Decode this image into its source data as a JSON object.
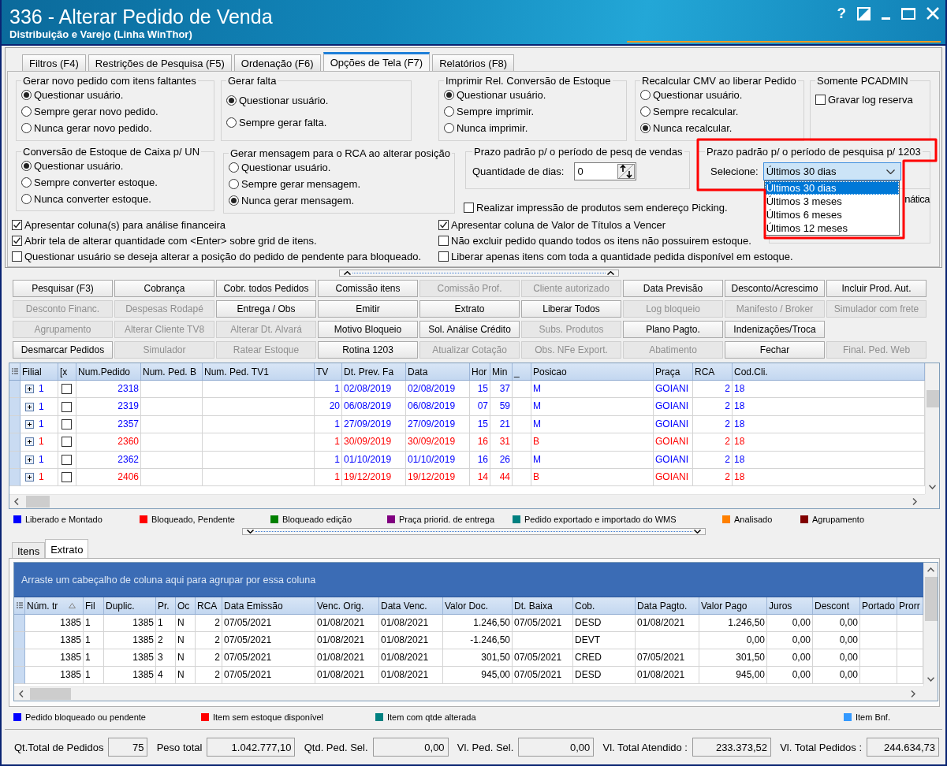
{
  "window": {
    "title": "336 - Alterar Pedido de Venda",
    "subtitle": "Distribuição e Varejo (Linha WinThor)",
    "help_button": "?"
  },
  "tabs": [
    {
      "label": "Filtros (F4)",
      "selected": false
    },
    {
      "label": "Restrições de Pesquisa (F5)",
      "selected": false
    },
    {
      "label": "Ordenação (F6)",
      "selected": false
    },
    {
      "label": "Opções de Tela (F7)",
      "selected": true
    },
    {
      "label": "Relatórios (F8)",
      "selected": false
    }
  ],
  "option_groups_top": [
    {
      "title": "Gerar novo pedido com itens faltantes",
      "kind": "radio",
      "options": [
        {
          "label": "Questionar usuário.",
          "selected": true
        },
        {
          "label": "Sempre gerar novo pedido.",
          "selected": false
        },
        {
          "label": "Nunca gerar novo pedido.",
          "selected": false
        }
      ]
    },
    {
      "title": "Gerar falta",
      "kind": "radio",
      "options": [
        {
          "label": "Questionar usuário.",
          "selected": true
        },
        {
          "label": "Sempre gerar falta.",
          "selected": false
        }
      ]
    },
    {
      "title": "Imprimir Rel. Conversão de Estoque",
      "kind": "radio",
      "options": [
        {
          "label": "Questionar usuário.",
          "selected": true
        },
        {
          "label": "Sempre imprimir.",
          "selected": false
        },
        {
          "label": "Nunca imprimir.",
          "selected": false
        }
      ]
    },
    {
      "title": "Recalcular CMV ao liberar Pedido",
      "kind": "radio",
      "options": [
        {
          "label": "Questionar usuário.",
          "selected": false
        },
        {
          "label": "Sempre recalcular.",
          "selected": false
        },
        {
          "label": "Nunca recalcular.",
          "selected": true
        }
      ]
    },
    {
      "title": "Somente PCADMIN",
      "kind": "checkbox",
      "options": [
        {
          "label": "Gravar log reserva",
          "checked": false
        }
      ]
    }
  ],
  "option_groups_bottom": [
    {
      "title": "Conversão de Estoque de Caixa p/ UN",
      "kind": "radio",
      "options": [
        {
          "label": "Questionar usuário.",
          "selected": true
        },
        {
          "label": "Sempre converter estoque.",
          "selected": false
        },
        {
          "label": "Nunca converter estoque.",
          "selected": false
        }
      ]
    },
    {
      "title": "Gerar mensagem para o RCA ao alterar posição",
      "kind": "radio",
      "options": [
        {
          "label": "Questionar usuário.",
          "selected": false
        },
        {
          "label": "Sempre gerar mensagem.",
          "selected": false
        },
        {
          "label": "Nunca gerar mensagem.",
          "selected": true
        }
      ]
    },
    {
      "title": "Prazo padrão p/ o período de pesq de vendas",
      "kind": "spin",
      "label": "Quantidade de dias:",
      "value": "0"
    },
    {
      "title": "Prazo padrão p/ o período de pesquisa p/ 1203",
      "kind": "select",
      "label": "Selecione:",
      "value": "Últimos 30 dias",
      "expanded": true,
      "options": [
        {
          "label": "Últimos 30 dias",
          "selected": true
        },
        {
          "label": "Últimos 3 meses",
          "selected": false
        },
        {
          "label": "Últimos 6 meses",
          "selected": false
        },
        {
          "label": "Últimos 12 meses",
          "selected": false
        }
      ]
    }
  ],
  "partly_hidden_option": {
    "label": "nática"
  },
  "picking_checkbox": {
    "label": "Realizar impressão de produtos sem endereço Picking.",
    "checked": false
  },
  "checkboxes_left": [
    {
      "label": "Apresentar coluna(s) para análise financeira",
      "checked": true
    },
    {
      "label": "Abrir tela de alterar quantidade com <Enter> sobre grid de itens.",
      "checked": true
    },
    {
      "label": "Questionar usuário se deseja alterar a posição do pedido de pendente para bloqueado.",
      "checked": false
    }
  ],
  "checkboxes_right": [
    {
      "label": "Apresentar coluna de Valor de Títulos a Vencer",
      "checked": true
    },
    {
      "label": "Não excluir pedido quando todos os itens não possuirem estoque.",
      "checked": false
    },
    {
      "label": "Liberar apenas itens com toda a quantidade pedida disponível em estoque.",
      "checked": false
    }
  ],
  "action_buttons": [
    [
      {
        "label": "Pesquisar (F3)",
        "disabled": false
      },
      {
        "label": "Cobrança",
        "disabled": false
      },
      {
        "label": "Cobr. todos Pedidos",
        "disabled": false
      },
      {
        "label": "Comissão itens",
        "disabled": false
      },
      {
        "label": "Comissão Prof.",
        "disabled": true
      },
      {
        "label": "Cliente autorizado",
        "disabled": true
      },
      {
        "label": "Data Previsão",
        "disabled": false
      },
      {
        "label": "Desconto/Acrescimo",
        "disabled": false
      },
      {
        "label": "Incluir Prod. Aut.",
        "disabled": false
      }
    ],
    [
      {
        "label": "Desconto Financ.",
        "disabled": true
      },
      {
        "label": "Despesas Rodapé",
        "disabled": true
      },
      {
        "label": "Entrega / Obs",
        "disabled": false
      },
      {
        "label": "Emitir",
        "disabled": false
      },
      {
        "label": "Extrato",
        "disabled": false
      },
      {
        "label": "Liberar Todos",
        "disabled": false
      },
      {
        "label": "Log bloqueio",
        "disabled": true
      },
      {
        "label": "Manifesto / Broker",
        "disabled": true
      },
      {
        "label": "Simulador com frete",
        "disabled": true
      }
    ],
    [
      {
        "label": "Agrupamento",
        "disabled": true
      },
      {
        "label": "Alterar Cliente TV8",
        "disabled": true
      },
      {
        "label": "Alterar Dt. Alvará",
        "disabled": true
      },
      {
        "label": "Motivo Bloqueio",
        "disabled": false
      },
      {
        "label": "Sol. Análise Crédito",
        "disabled": false
      },
      {
        "label": "Subs. Produtos",
        "disabled": true
      },
      {
        "label": "Plano Pagto.",
        "disabled": false
      },
      {
        "label": "Indenizações/Troca",
        "disabled": false
      }
    ],
    [
      {
        "label": "Desmarcar Pedidos",
        "disabled": false
      },
      {
        "label": "Simulador",
        "disabled": true
      },
      {
        "label": "Ratear Estoque",
        "disabled": true
      },
      {
        "label": "Rotina 1203",
        "disabled": false
      },
      {
        "label": "Atualizar Cotação",
        "disabled": true
      },
      {
        "label": "Obs. NFe Export.",
        "disabled": true
      },
      {
        "label": "Abatimento",
        "disabled": true
      },
      {
        "label": "Fechar",
        "disabled": false
      },
      {
        "label": "Final. Ped. Web",
        "disabled": true
      }
    ]
  ],
  "orders_table": {
    "columns": [
      "Filial",
      "[x",
      "Num.Pedido",
      "Num. Ped. B",
      "Num. Ped. TV1",
      "TV",
      "Dt. Prev. Fa",
      "Data",
      "Hor",
      "Min",
      "_",
      "Posicao",
      "Praça",
      "RCA",
      "Cod.Cli."
    ],
    "rows": [
      {
        "expanded": false,
        "checked": false,
        "color": "#0000ff",
        "cells": [
          "1",
          null,
          "2318",
          null,
          null,
          "1",
          "02/08/2019",
          "02/08/2019",
          "15",
          "37",
          null,
          "M",
          "GOIANI",
          "2",
          "18"
        ]
      },
      {
        "expanded": false,
        "checked": false,
        "color": "#0000ff",
        "cells": [
          "1",
          null,
          "2319",
          null,
          null,
          "20",
          "06/08/2019",
          "06/08/2019",
          "07",
          "59",
          null,
          "M",
          "GOIANI",
          "2",
          "18"
        ]
      },
      {
        "expanded": false,
        "checked": false,
        "color": "#0000ff",
        "cells": [
          "1",
          null,
          "2357",
          null,
          null,
          "1",
          "27/09/2019",
          "27/09/2019",
          "15",
          "21",
          null,
          "M",
          "GOIANI",
          "2",
          "18"
        ]
      },
      {
        "expanded": false,
        "checked": false,
        "color": "#ff0000",
        "cells": [
          "1",
          null,
          "2360",
          null,
          null,
          "1",
          "30/09/2019",
          "30/09/2019",
          "16",
          "31",
          null,
          "B",
          "GOIANI",
          "2",
          "18"
        ]
      },
      {
        "expanded": false,
        "checked": false,
        "color": "#0000ff",
        "cells": [
          "1",
          null,
          "2362",
          null,
          null,
          "1",
          "01/10/2019",
          "01/10/2019",
          "16",
          "26",
          null,
          "M",
          "GOIANI",
          "2",
          "18"
        ]
      },
      {
        "expanded": false,
        "checked": false,
        "color": "#ff0000",
        "cells": [
          "1",
          null,
          "2406",
          null,
          null,
          "1",
          "19/12/2019",
          "19/12/2019",
          "14",
          "44",
          null,
          "B",
          "GOIANI",
          "2",
          "18"
        ]
      }
    ]
  },
  "order_legend": [
    {
      "label": "Liberado e Montado",
      "color": "#0000ff"
    },
    {
      "label": "Bloqueado, Pendente",
      "color": "#ff0000"
    },
    {
      "label": "Bloqueado edição",
      "color": "#008000"
    },
    {
      "label": "Praça priorid. de entrega",
      "color": "#800080"
    },
    {
      "label": "Pedido exportado e importado do WMS",
      "color": "#008080"
    },
    {
      "label": "Analisado",
      "color": "#ff8000"
    },
    {
      "label": "Agrupamento",
      "color": "#800000"
    }
  ],
  "detail_tabs": [
    {
      "label": "Itens",
      "selected": false
    },
    {
      "label": "Extrato",
      "selected": true
    }
  ],
  "statement_table": {
    "group_hint": "Arraste um cabeçalho de coluna aqui para agrupar por essa coluna",
    "columns": [
      {
        "label": "Núm. tr",
        "sorted": true
      },
      {
        "label": "Fil",
        "sorted": false
      },
      {
        "label": "Duplic.",
        "sorted": false
      },
      {
        "label": "Pr.",
        "sorted": false
      },
      {
        "label": "Oc",
        "sorted": false
      },
      {
        "label": "RCA",
        "sorted": false
      },
      {
        "label": "Data Emissão",
        "sorted": false
      },
      {
        "label": "Venc. Orig.",
        "sorted": false
      },
      {
        "label": "Data Venc.",
        "sorted": false
      },
      {
        "label": "Valor Doc.",
        "sorted": false
      },
      {
        "label": "Dt. Baixa",
        "sorted": false
      },
      {
        "label": "Cob.",
        "sorted": false
      },
      {
        "label": "Data Pagto.",
        "sorted": false
      },
      {
        "label": "Valor Pago",
        "sorted": false
      },
      {
        "label": "Juros",
        "sorted": false
      },
      {
        "label": "Descont",
        "sorted": false
      },
      {
        "label": "Portado",
        "sorted": false
      },
      {
        "label": "Prorr",
        "sorted": false
      }
    ],
    "rows": [
      [
        "1385",
        "1",
        "1385",
        "1",
        "N",
        "2",
        "07/05/2021",
        "01/08/2021",
        "01/08/2021",
        "1.246,50",
        "07/05/2021",
        "DESD",
        "01/08/2021",
        "1.246,50",
        "0,00",
        "0,00",
        null,
        null
      ],
      [
        "1385",
        "1",
        "1385",
        "2",
        "N",
        "2",
        "07/05/2021",
        "01/08/2021",
        "01/08/2021",
        "-1.246,50",
        null,
        "DEVT",
        null,
        "0,00",
        "0,00",
        "0,00",
        null,
        null
      ],
      [
        "1385",
        "1",
        "1385",
        "3",
        "N",
        "2",
        "07/05/2021",
        "01/08/2021",
        "01/08/2021",
        "301,50",
        "07/05/2021",
        "CRED",
        "07/05/2021",
        "301,50",
        "0,00",
        "0,00",
        null,
        null
      ],
      [
        "1385",
        "1",
        "1385",
        "4",
        "N",
        "2",
        "07/05/2021",
        "01/08/2021",
        "01/08/2021",
        "945,00",
        "07/05/2021",
        "DESD",
        "01/08/2021",
        "945,00",
        "0,00",
        "0,00",
        null,
        null
      ]
    ]
  },
  "item_legend": [
    {
      "label": "Pedido bloqueado ou pendente",
      "color": "#0000ff"
    },
    {
      "label": "Item sem estoque disponível",
      "color": "#ff0000"
    },
    {
      "label": "Item com qtde alterada",
      "color": "#008080"
    },
    {
      "label": "Item Bnf.",
      "color": "#3399ff"
    }
  ],
  "totals": [
    {
      "label": "Qt.Total de Pedidos",
      "value": "75"
    },
    {
      "label": "Peso total",
      "value": "1.042.777,10"
    },
    {
      "label": "Qtd. Ped. Sel.",
      "value": "0,00"
    },
    {
      "label": "Vl. Ped. Sel.",
      "value": "0,00"
    },
    {
      "label": "Vl. Total Atendido :",
      "value": "233.373,52"
    },
    {
      "label": "Vl. Total Pedidos :",
      "value": "244.634,73"
    }
  ]
}
